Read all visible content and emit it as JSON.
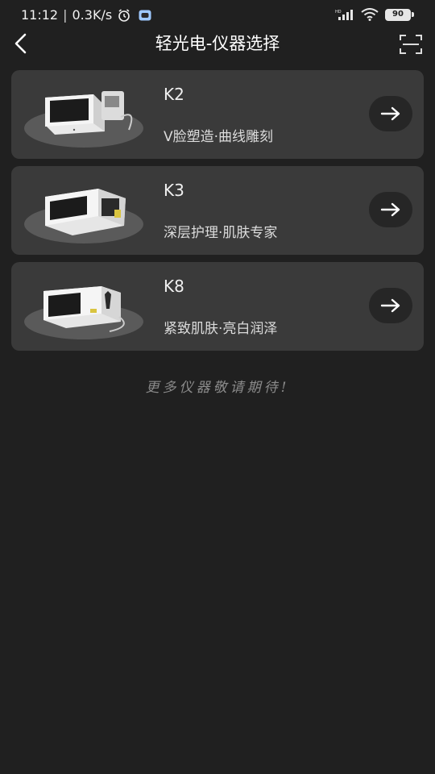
{
  "status_bar": {
    "time": "11:12",
    "network_speed": "0.3K/s",
    "battery_level": "90",
    "icons": [
      "alarm-icon",
      "message-icon",
      "signal-icon",
      "wifi-icon",
      "battery-icon"
    ]
  },
  "nav": {
    "title": "轻光电-仪器选择",
    "back_icon": "chevron-left-icon",
    "scan_icon": "scan-icon"
  },
  "devices": [
    {
      "name": "K2",
      "description": "V脸塑造·曲线雕刻"
    },
    {
      "name": "K3",
      "description": "深层护理·肌肤专家"
    },
    {
      "name": "K8",
      "description": "紧致肌肤·亮白润泽"
    }
  ],
  "footer": {
    "text": "更多仪器敬请期待!"
  },
  "colors": {
    "background": "#202020",
    "card": "#3a3a3a",
    "arrow_button": "#262626",
    "text_primary": "#ffffff",
    "text_muted": "#8a8a8a"
  }
}
